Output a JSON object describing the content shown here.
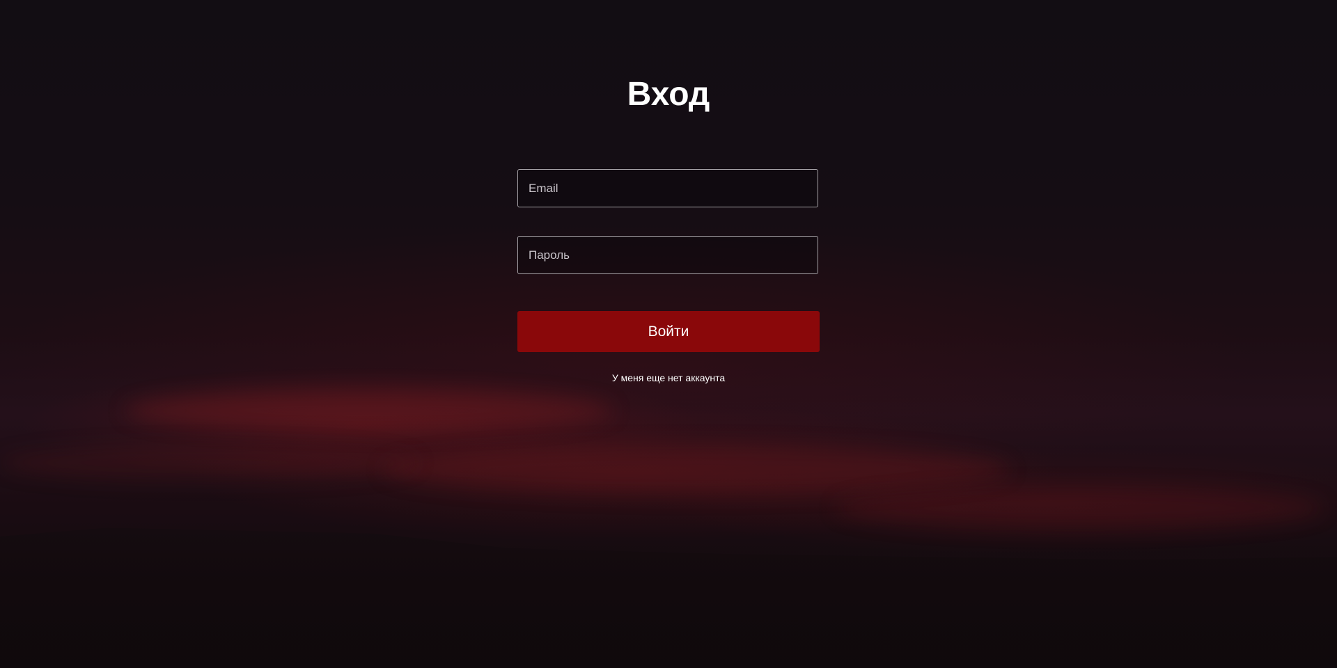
{
  "login": {
    "title": "Вход",
    "email_placeholder": "Email",
    "password_placeholder": "Пароль",
    "submit_label": "Войти",
    "register_link": "У меня еще нет аккаунта"
  },
  "colors": {
    "background": "#120d12",
    "accent": "#8a080a",
    "field_border": "#a7a3a8",
    "text": "#ffffff"
  }
}
